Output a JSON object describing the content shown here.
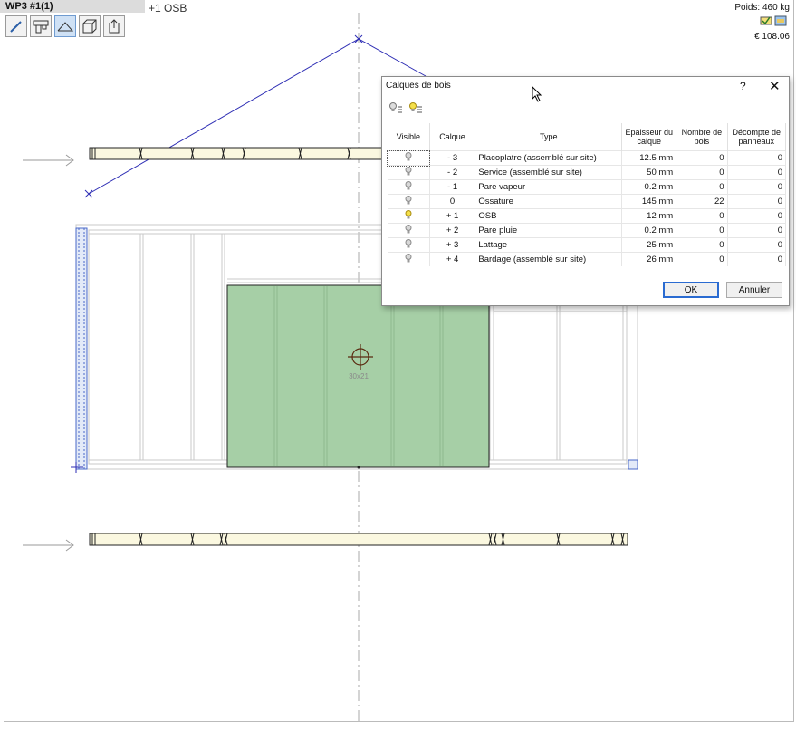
{
  "window": {
    "title": "WP3 #1(1)",
    "active_layer": "+1 OSB"
  },
  "status": {
    "weight": "Poids: 460 kg",
    "price": "€ 108.06"
  },
  "toolbar": {
    "icons": [
      "pencil-icon",
      "plan-view-icon",
      "roof-view-icon",
      "3d-box-icon",
      "export-icon"
    ]
  },
  "drawing": {
    "dimension_label": "30x21",
    "panel_fill": "#a6cfa6",
    "roof_line_color": "#2d2db4"
  },
  "dialog": {
    "title": "Calques de bois",
    "help": "?",
    "close": "✕",
    "columns": [
      "Visible",
      "Calque",
      "Type",
      "Epaisseur du calque",
      "Nombre de bois",
      "Décompte de panneaux"
    ],
    "rows": [
      {
        "calque": "- 3",
        "type": "Placoplatre (assemblé sur site)",
        "epaisseur": "12.5 mm",
        "nombre": "0",
        "decompte": "0",
        "visible": false
      },
      {
        "calque": "- 2",
        "type": "Service (assemblé sur site)",
        "epaisseur": "50 mm",
        "nombre": "0",
        "decompte": "0",
        "visible": false
      },
      {
        "calque": "- 1",
        "type": "Pare vapeur",
        "epaisseur": "0.2 mm",
        "nombre": "0",
        "decompte": "0",
        "visible": false
      },
      {
        "calque": "0",
        "type": "Ossature",
        "epaisseur": "145 mm",
        "nombre": "22",
        "decompte": "0",
        "visible": false
      },
      {
        "calque": "+ 1",
        "type": "OSB",
        "epaisseur": "12 mm",
        "nombre": "0",
        "decompte": "0",
        "visible": true
      },
      {
        "calque": "+ 2",
        "type": "Pare pluie",
        "epaisseur": "0.2 mm",
        "nombre": "0",
        "decompte": "0",
        "visible": false
      },
      {
        "calque": "+ 3",
        "type": "Lattage",
        "epaisseur": "25 mm",
        "nombre": "0",
        "decompte": "0",
        "visible": false
      },
      {
        "calque": "+ 4",
        "type": "Bardage (assemblé sur site)",
        "epaisseur": "26 mm",
        "nombre": "0",
        "decompte": "0",
        "visible": false
      }
    ],
    "ok_label": "OK",
    "cancel_label": "Annuler"
  }
}
